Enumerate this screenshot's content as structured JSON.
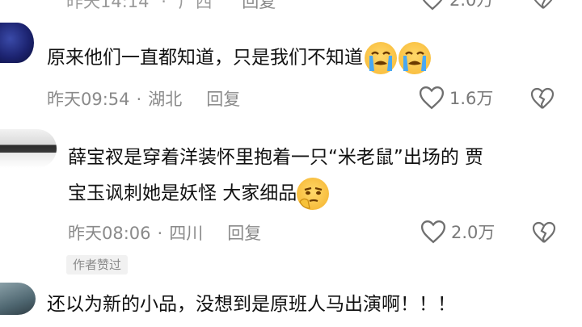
{
  "top_partial": {
    "time": "昨天14:14",
    "location": "广西",
    "reply": "回复",
    "likes": "2.0万"
  },
  "comments": [
    {
      "text": "原来他们一直都知道，只是我们不知道",
      "time": "昨天09:54",
      "location": "湖北",
      "reply": "回复",
      "likes": "1.6万"
    },
    {
      "text_line1": "薛宝衩是穿着洋装怀里抱着一只“米老鼠”出场的 贾",
      "text_line2": "宝玉讽刺她是妖怪  大家细品",
      "time": "昨天08:06",
      "location": "四川",
      "reply": "回复",
      "likes": "2.0万",
      "author_badge": "作者赞过"
    },
    {
      "text": "还以为新的小品，没想到是原班人马出演啊！！！"
    }
  ],
  "icons": {
    "like": "heart-outline-icon",
    "dislike": "broken-heart-icon",
    "emoji_cry": "loudly-crying-face-icon",
    "emoji_smirk": "thinking-face-icon"
  }
}
